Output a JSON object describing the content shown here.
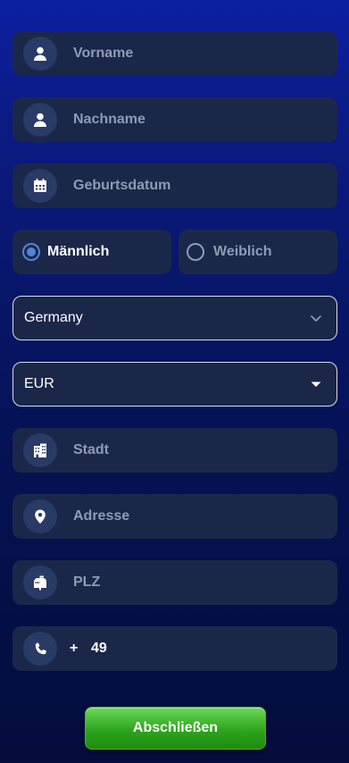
{
  "form": {
    "first_name": {
      "placeholder": "Vorname",
      "icon": "user-icon"
    },
    "last_name": {
      "placeholder": "Nachname",
      "icon": "user-icon"
    },
    "birthdate": {
      "placeholder": "Geburtsdatum",
      "icon": "calendar-icon"
    },
    "gender": {
      "options": [
        {
          "label": "Männlich",
          "checked": true
        },
        {
          "label": "Weiblich",
          "checked": false
        }
      ]
    },
    "country": {
      "value": "Germany"
    },
    "currency": {
      "value": "EUR"
    },
    "city": {
      "placeholder": "Stadt",
      "icon": "building-icon"
    },
    "address": {
      "placeholder": "Adresse",
      "icon": "location-pin-icon"
    },
    "zip": {
      "placeholder": "PLZ",
      "icon": "mailbox-icon"
    },
    "phone": {
      "prefix": "+",
      "country_code": "49",
      "icon": "phone-icon"
    },
    "submit_label": "Abschließen"
  },
  "colors": {
    "field_bg": "#1b2749",
    "icon_bg": "#2a3a66",
    "placeholder": "#8f9ab5",
    "radio_accent": "#4f86d8",
    "button_green": "#2ea51c"
  }
}
